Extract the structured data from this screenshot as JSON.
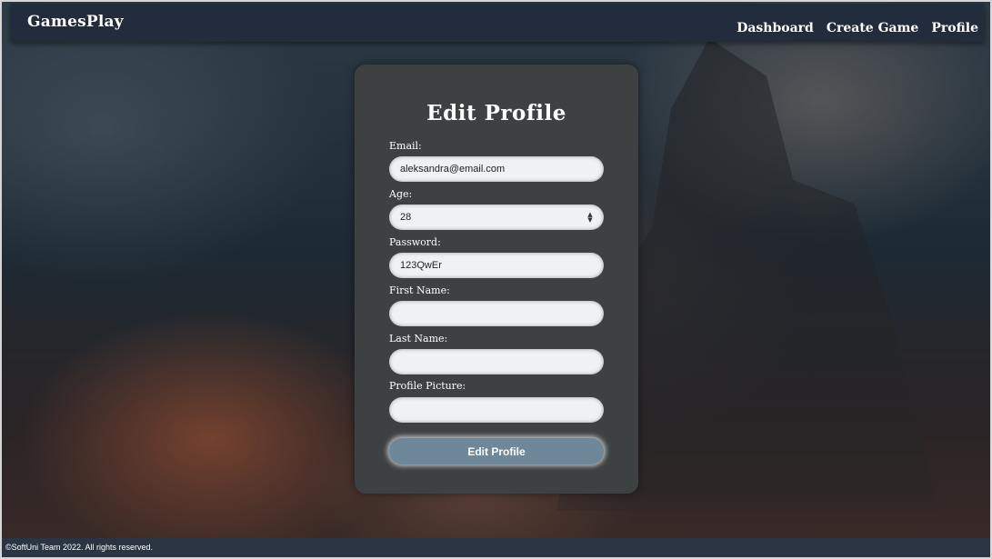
{
  "header": {
    "brand": "GamesPlay",
    "nav": [
      "Dashboard",
      "Create Game",
      "Profile"
    ]
  },
  "form": {
    "title": "Edit Profile",
    "fields": [
      {
        "label": "Email:",
        "value": "aleksandra@email.com"
      },
      {
        "label": "Age:",
        "value": "28"
      },
      {
        "label": "Password:",
        "value": "123QwEr"
      },
      {
        "label": "First Name:",
        "value": ""
      },
      {
        "label": "Last Name:",
        "value": ""
      },
      {
        "label": "Profile Picture:",
        "value": ""
      }
    ],
    "submit_label": "Edit Profile"
  },
  "footer": {
    "text": "©SoftUni Team 2022. All rights reserved."
  },
  "colors": {
    "header_bg": "#232c3c",
    "card_bg": "#3d4141",
    "button_bg": "#6e8799",
    "field_bg": "#eef2f2"
  }
}
